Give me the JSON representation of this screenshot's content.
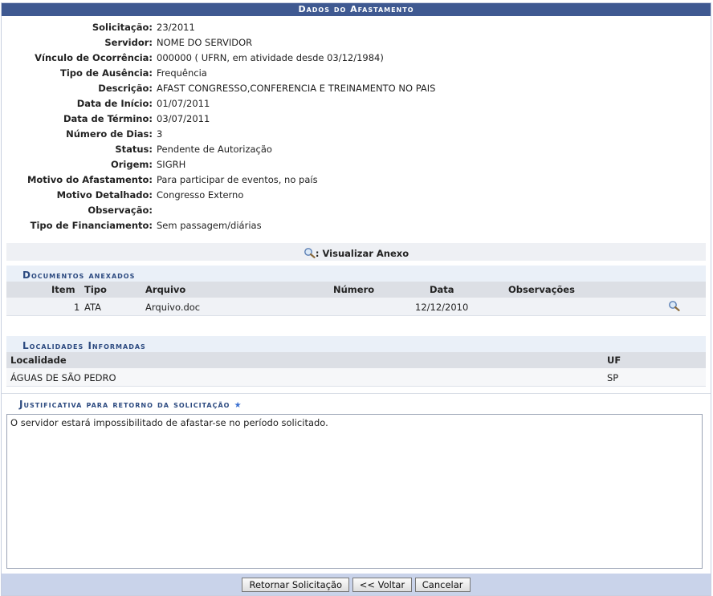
{
  "title": "Dados do Afastamento",
  "fields": [
    {
      "label": "Solicitação:",
      "value": "23/2011"
    },
    {
      "label": "Servidor:",
      "value": "NOME DO SERVIDOR"
    },
    {
      "label": "Vínculo de Ocorrência:",
      "value": "000000 ( UFRN, em atividade desde 03/12/1984)"
    },
    {
      "label": "Tipo de Ausência:",
      "value": "Frequência"
    },
    {
      "label": "Descrição:",
      "value": "AFAST CONGRESSO,CONFERENCIA E TREINAMENTO NO PAIS"
    },
    {
      "label": "Data de Início:",
      "value": "01/07/2011"
    },
    {
      "label": "Data de Término:",
      "value": "03/07/2011"
    },
    {
      "label": "Número de Dias:",
      "value": "3"
    },
    {
      "label": "Status:",
      "value": "Pendente de Autorização"
    },
    {
      "label": "Origem:",
      "value": "SIGRH"
    },
    {
      "label": "Motivo do Afastamento:",
      "value": "Para participar de eventos, no país"
    },
    {
      "label": "Motivo Detalhado:",
      "value": "Congresso Externo"
    },
    {
      "label": "Observação:",
      "value": ""
    },
    {
      "label": "Tipo de Financiamento:",
      "value": "Sem passagem/diárias"
    }
  ],
  "anexo": {
    "label": ": Visualizar Anexo",
    "icon": "magnifier-icon"
  },
  "documentos": {
    "title": "Documentos anexados",
    "columns": [
      "Item",
      "Tipo",
      "Arquivo",
      "Número",
      "Data",
      "Observações"
    ],
    "rows": [
      {
        "item": "1",
        "tipo": "ATA",
        "arquivo": "Arquivo.doc",
        "numero": "",
        "data": "12/12/2010",
        "observacoes": ""
      }
    ]
  },
  "localidades": {
    "title": "Localidades Informadas",
    "columns": [
      "Localidade",
      "UF"
    ],
    "rows": [
      {
        "localidade": "ÁGUAS DE SÃO PEDRO",
        "uf": "SP"
      }
    ]
  },
  "justificativa": {
    "title": "Justificativa para retorno da solicitação",
    "required_mark": "★",
    "text": "O servidor estará impossibilitado de afastar-se no período solicitado."
  },
  "buttons": {
    "retornar": "Retornar Solicitação",
    "voltar": "<< Voltar",
    "cancelar": "Cancelar"
  },
  "colors": {
    "header": "#3f5991",
    "section_text": "#2c4a80",
    "button_bar": "#c9d3ea"
  }
}
